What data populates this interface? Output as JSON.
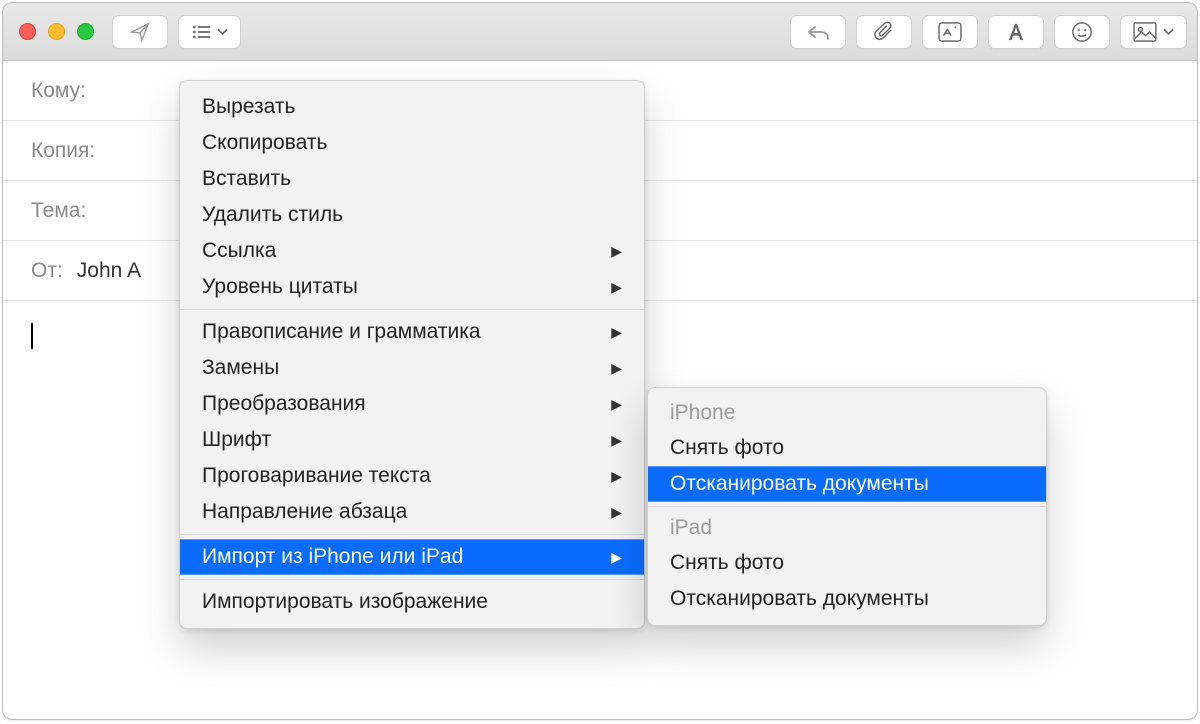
{
  "fields": {
    "to_label": "Кому:",
    "cc_label": "Копия:",
    "subject_label": "Тема:",
    "from_label": "От:",
    "from_value": "John A"
  },
  "context_menu": {
    "items": [
      {
        "label": "Вырезать",
        "submenu": false
      },
      {
        "label": "Скопировать",
        "submenu": false
      },
      {
        "label": "Вставить",
        "submenu": false
      },
      {
        "label": "Удалить стиль",
        "submenu": false
      },
      {
        "label": "Ссылка",
        "submenu": true
      },
      {
        "label": "Уровень цитаты",
        "submenu": true
      }
    ],
    "items2": [
      {
        "label": "Правописание и грамматика",
        "submenu": true
      },
      {
        "label": "Замены",
        "submenu": true
      },
      {
        "label": "Преобразования",
        "submenu": true
      },
      {
        "label": "Шрифт",
        "submenu": true
      },
      {
        "label": "Проговаривание текста",
        "submenu": true
      },
      {
        "label": "Направление абзаца",
        "submenu": true
      }
    ],
    "import_item": {
      "label": "Импорт из iPhone или iPad",
      "submenu": true,
      "highlight": true
    },
    "items3": [
      {
        "label": "Импортировать изображение",
        "submenu": false
      }
    ]
  },
  "submenu": {
    "iphone_header": "iPhone",
    "ipad_header": "iPad",
    "take_photo": "Снять фото",
    "scan_docs": "Отсканировать документы"
  }
}
